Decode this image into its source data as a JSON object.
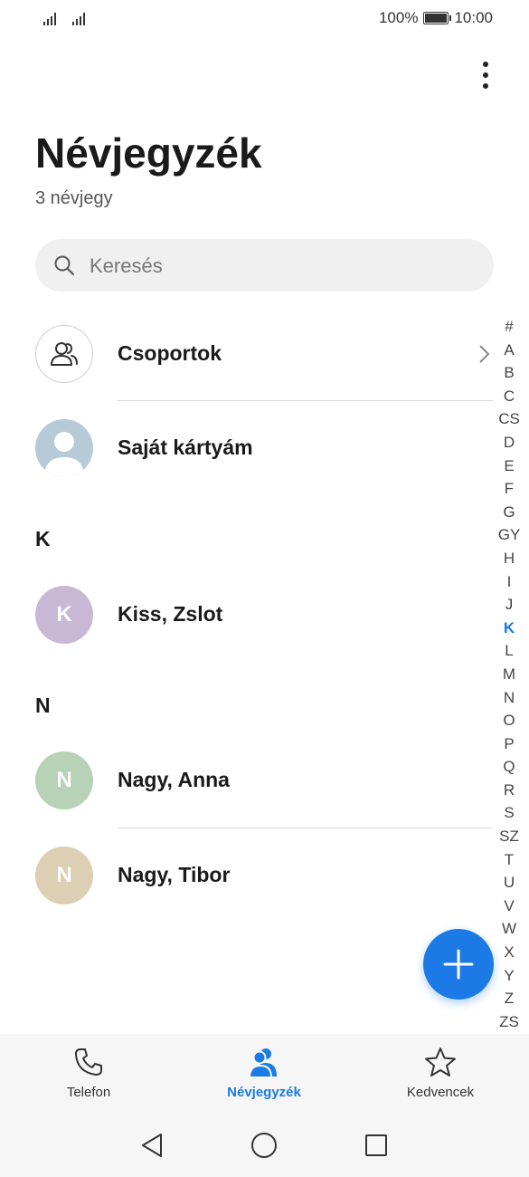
{
  "status_bar": {
    "battery": "100%",
    "time": "10:00"
  },
  "header": {
    "title": "Névjegyzék",
    "count": "3 névjegy",
    "menu_icon": "more-vertical-icon"
  },
  "search": {
    "placeholder": "Keresés",
    "icon": "search-icon"
  },
  "groups": {
    "label": "Csoportok",
    "icon": "people-icon"
  },
  "my_card": {
    "label": "Saját kártyám",
    "icon": "person-placeholder-icon"
  },
  "sections": [
    {
      "letter": "K",
      "contacts": [
        {
          "initial": "K",
          "name": "Kiss, Zslot",
          "color": "#c8b8d6"
        }
      ]
    },
    {
      "letter": "N",
      "contacts": [
        {
          "initial": "N",
          "name": "Nagy, Anna",
          "color": "#b7d2b6"
        },
        {
          "initial": "N",
          "name": "Nagy, Tibor",
          "color": "#dccfb3"
        }
      ]
    }
  ],
  "alphabet": [
    "#",
    "A",
    "B",
    "C",
    "CS",
    "D",
    "E",
    "F",
    "G",
    "GY",
    "H",
    "I",
    "J",
    "K",
    "L",
    "M",
    "N",
    "O",
    "P",
    "Q",
    "R",
    "S",
    "SZ",
    "T",
    "U",
    "V",
    "W",
    "X",
    "Y",
    "Z",
    "ZS"
  ],
  "alphabet_active": "K",
  "fab": {
    "icon": "plus-icon"
  },
  "tabs": [
    {
      "label": "Telefon",
      "icon": "phone-icon",
      "active": false
    },
    {
      "label": "Névjegyzék",
      "icon": "contacts-icon",
      "active": true
    },
    {
      "label": "Kedvencek",
      "icon": "star-icon",
      "active": false
    }
  ],
  "nav": {
    "back_icon": "back-triangle-icon",
    "home_icon": "home-circle-icon",
    "recents_icon": "recents-square-icon"
  },
  "colors": {
    "accent": "#1b7ae6",
    "my_card_avatar": "#b6cad8"
  }
}
